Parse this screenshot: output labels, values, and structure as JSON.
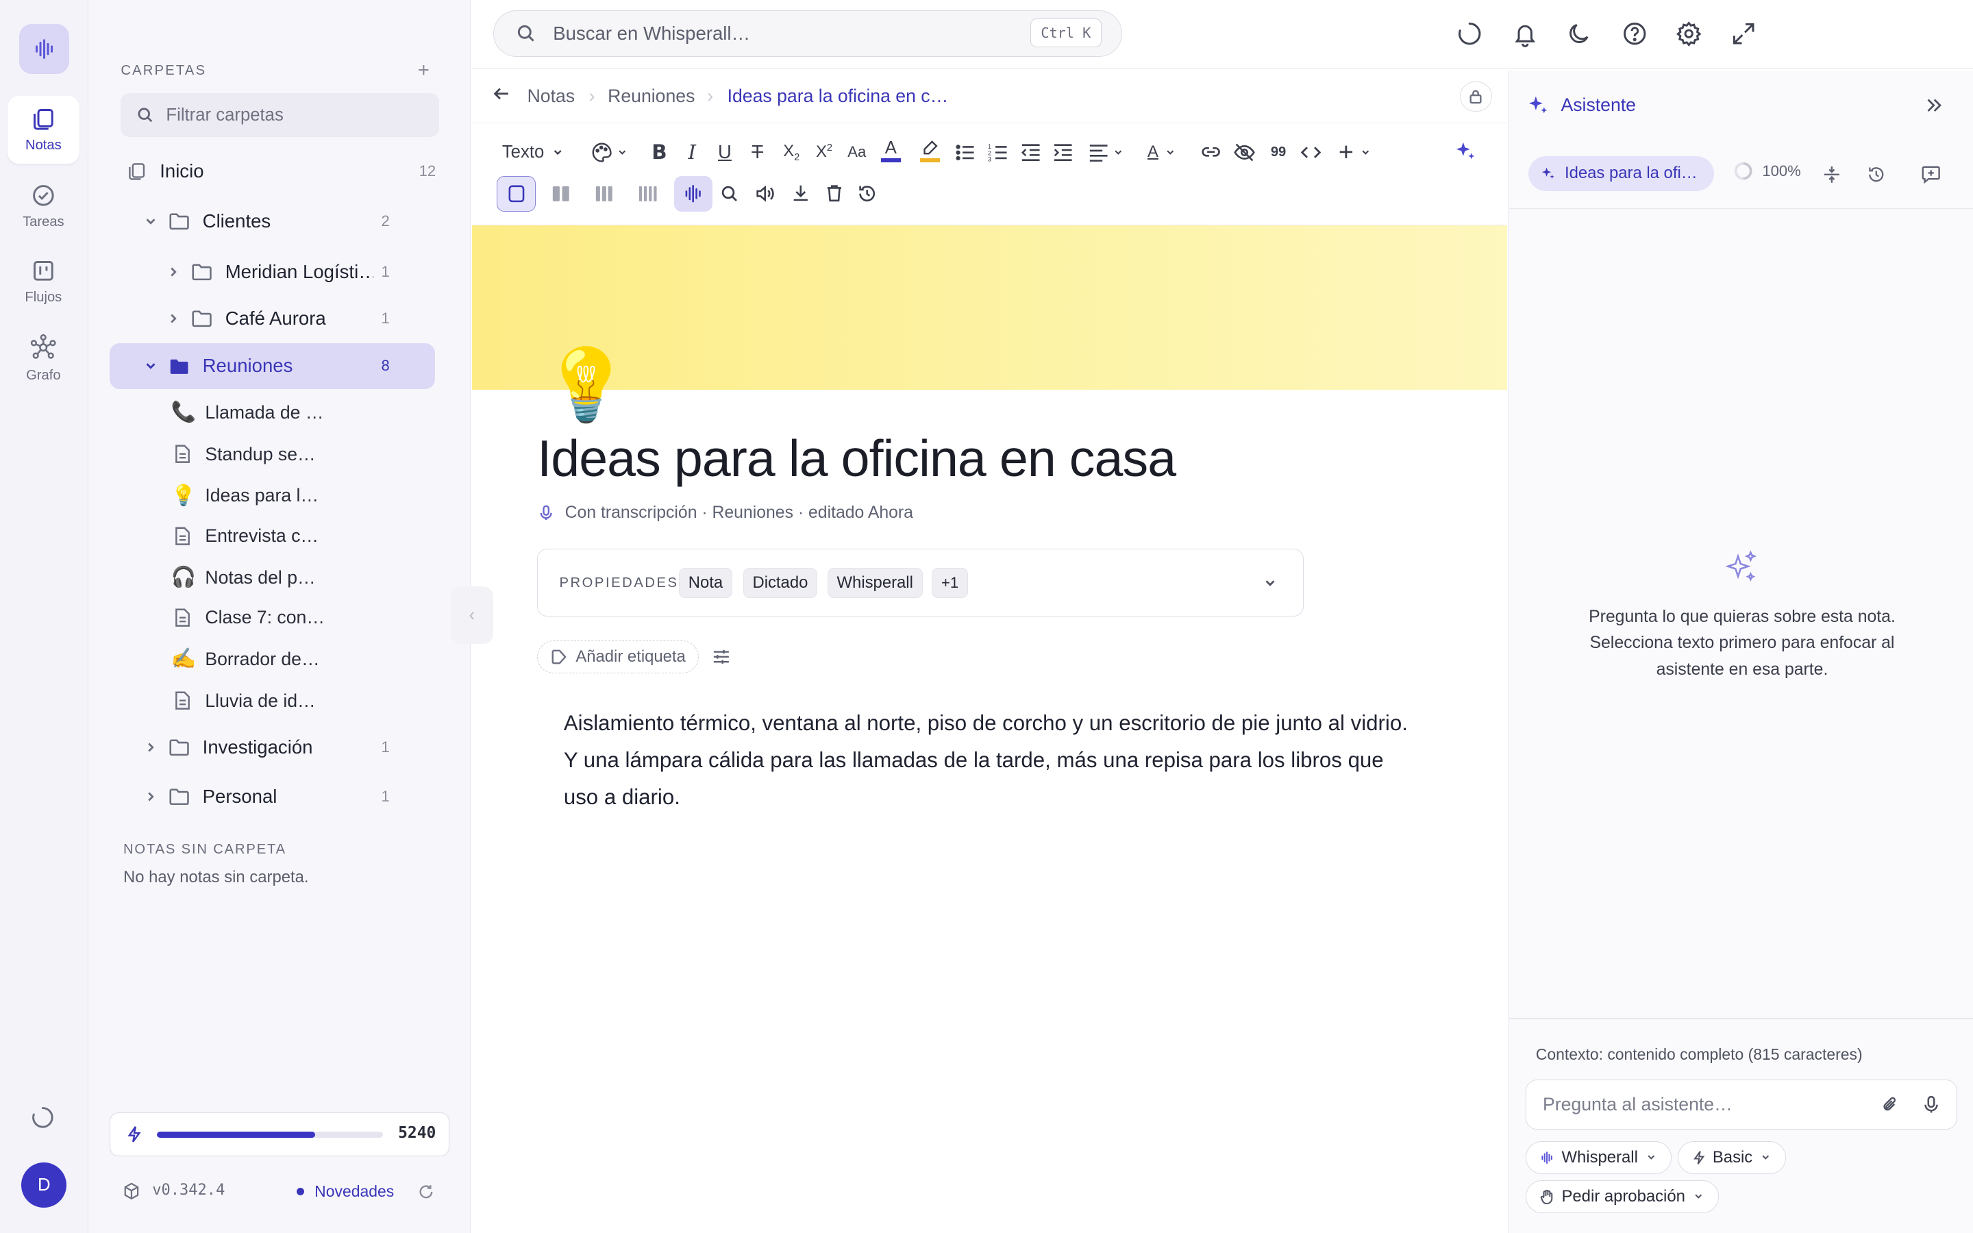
{
  "rail": {
    "items": [
      {
        "label": "Notas",
        "icon": "notes-icon",
        "active": true
      },
      {
        "label": "Tareas",
        "icon": "check-circle-icon"
      },
      {
        "label": "Flujos",
        "icon": "kanban-icon"
      },
      {
        "label": "Grafo",
        "icon": "graph-icon"
      }
    ],
    "avatar_initial": "D"
  },
  "sidebar": {
    "heading": "CARPETAS",
    "add_symbol": "+",
    "filter_placeholder": "Filtrar carpetas",
    "home": {
      "label": "Inicio",
      "count": "12"
    },
    "folders": [
      {
        "label": "Clientes",
        "count": "2",
        "expanded": true
      },
      {
        "label": "Meridian Logísti…",
        "count": "1"
      },
      {
        "label": "Café Aurora",
        "count": "1"
      },
      {
        "label": "Reuniones",
        "count": "8",
        "expanded": true,
        "selected": true
      },
      {
        "label": "Investigación",
        "count": "1"
      },
      {
        "label": "Personal",
        "count": "1"
      }
    ],
    "notes": [
      {
        "emoji": "📞",
        "label": "Llamada de …"
      },
      {
        "emoji": "",
        "label": "Standup se…"
      },
      {
        "emoji": "💡",
        "label": "Ideas para l…"
      },
      {
        "emoji": "",
        "label": "Entrevista c…"
      },
      {
        "emoji": "🎧",
        "label": "Notas del p…"
      },
      {
        "emoji": "",
        "label": "Clase 7: con…"
      },
      {
        "emoji": "✍️",
        "label": "Borrador de…"
      },
      {
        "emoji": "",
        "label": "Lluvia de id…"
      }
    ],
    "unfiled_heading": "NOTAS SIN CARPETA",
    "unfiled_empty": "No hay notas sin carpeta.",
    "credits": {
      "value": "5240",
      "fraction": 0.7
    },
    "version": "v0.342.4",
    "news_label": "Novedades"
  },
  "topbar": {
    "search_placeholder": "Buscar en Whisperall…",
    "shortcut": "Ctrl K",
    "icons": [
      "loading-icon",
      "bell-icon",
      "moon-icon",
      "help-icon",
      "settings-icon",
      "expand-icon"
    ]
  },
  "editor": {
    "breadcrumb": [
      "Notas",
      "Reuniones",
      "Ideas para la oficina en c…"
    ],
    "toolbar": {
      "style_label": "Texto",
      "quote_symbol": "99"
    },
    "emoji": "💡",
    "title": "Ideas para la oficina en casa",
    "meta": "Con transcripción · Reuniones · editado Ahora",
    "properties_label": "PROPIEDADES",
    "properties": [
      "Nota",
      "Dictado",
      "Whisperall",
      "+1"
    ],
    "add_tag": "Añadir etiqueta",
    "body": "Aislamiento térmico, ventana al norte, piso de corcho y un escritorio de pie junto al vidrio. Y una lámpara cálida para las llamadas de la tarde, más una repisa para los libros que uso a diario."
  },
  "assistant": {
    "title": "Asistente",
    "context_chip": "Ideas para la ofi…",
    "zoom": "100%",
    "empty_text": "Pregunta lo que quieras sobre esta nota. Selecciona texto primero para enfocar al asistente en esa parte.",
    "context_info": "Contexto: contenido completo (815 caracteres)",
    "input_placeholder": "Pregunta al asistente…",
    "model_pill": "Whisperall",
    "mode_pill": "Basic",
    "approval_pill": "Pedir aprobación"
  },
  "colors": {
    "accent": "#3a36b8",
    "banner": "#fdec85",
    "selection": "#dcd9f7"
  }
}
